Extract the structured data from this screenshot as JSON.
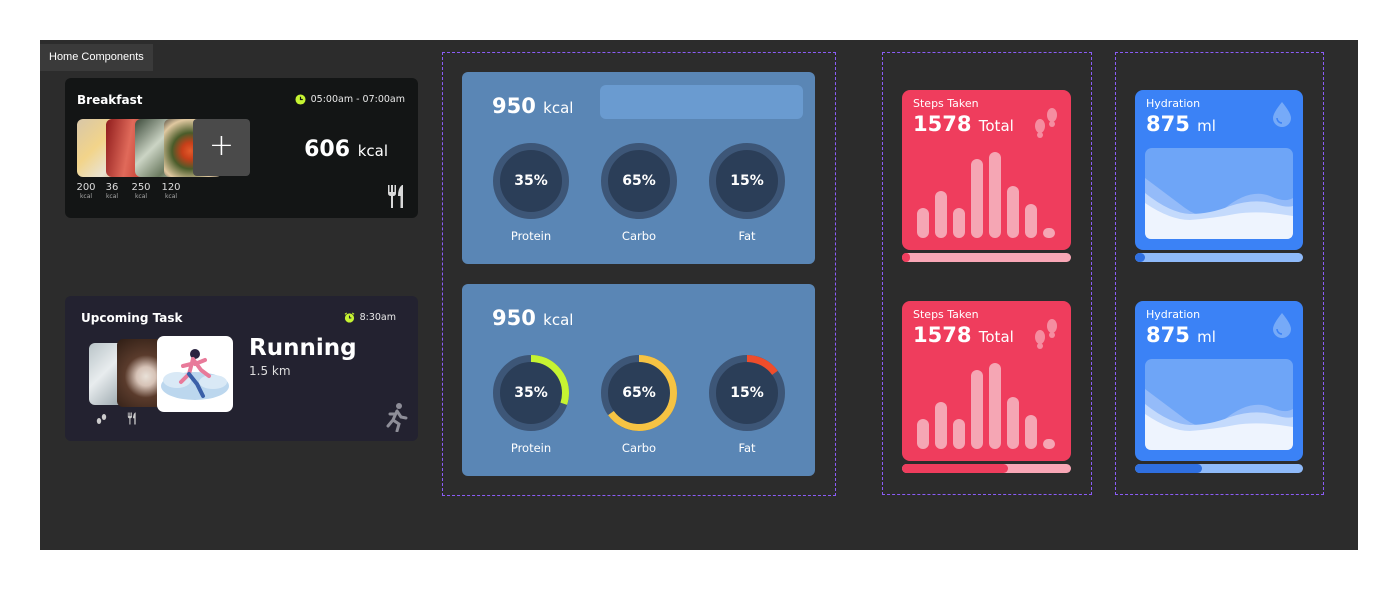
{
  "frame": {
    "tab_label": "Home Components"
  },
  "breakfast": {
    "title": "Breakfast",
    "time": "05:00am - 07:00am",
    "items": [
      {
        "value": "200",
        "unit": "kcal"
      },
      {
        "value": "36",
        "unit": "kcal"
      },
      {
        "value": "250",
        "unit": "kcal"
      },
      {
        "value": "120",
        "unit": "kcal"
      }
    ],
    "total_value": "606",
    "total_unit": "kcal",
    "add_label": "+",
    "icon": "fork-knife-icon"
  },
  "task": {
    "title": "Upcoming Task",
    "time": "8:30am",
    "name": "Running",
    "distance": "1.5 km",
    "icon": "running-person-icon"
  },
  "macro_cards": [
    {
      "kcal_value": "950",
      "kcal_unit": "kcal",
      "rings": [
        {
          "label": "Protein",
          "pct": "35%",
          "fraction": 0,
          "color": "#c6f432"
        },
        {
          "label": "Carbo",
          "pct": "65%",
          "fraction": 0,
          "color": "#f6c343"
        },
        {
          "label": "Fat",
          "pct": "15%",
          "fraction": 0,
          "color": "#ef4d2b"
        }
      ]
    },
    {
      "kcal_value": "950",
      "kcal_unit": "kcal",
      "rings": [
        {
          "label": "Protein",
          "pct": "35%",
          "fraction": 0.3,
          "color": "#c6f432"
        },
        {
          "label": "Carbo",
          "pct": "65%",
          "fraction": 0.65,
          "color": "#f6c343"
        },
        {
          "label": "Fat",
          "pct": "15%",
          "fraction": 0.15,
          "color": "#ef4d2b"
        }
      ]
    }
  ],
  "steps_cards": [
    {
      "caption": "Steps Taken",
      "value": "1578",
      "unit": "Total",
      "progress": 0.05,
      "bars": [
        0.35,
        0.55,
        0.35,
        0.92,
        1.0,
        0.6,
        0.4,
        0.12
      ]
    },
    {
      "caption": "Steps Taken",
      "value": "1578",
      "unit": "Total",
      "progress": 0.63,
      "bars": [
        0.35,
        0.55,
        0.35,
        0.92,
        1.0,
        0.6,
        0.4,
        0.12
      ]
    }
  ],
  "hydration_cards": [
    {
      "caption": "Hydration",
      "value": "875",
      "unit": "ml",
      "progress": 0.06
    },
    {
      "caption": "Hydration",
      "value": "875",
      "unit": "ml",
      "progress": 0.4
    }
  ],
  "colors": {
    "steps": "#ef3d5d",
    "hydration": "#3b82f6",
    "macro_bg": "#5a86b5",
    "dashed": "#8b5cf6"
  }
}
